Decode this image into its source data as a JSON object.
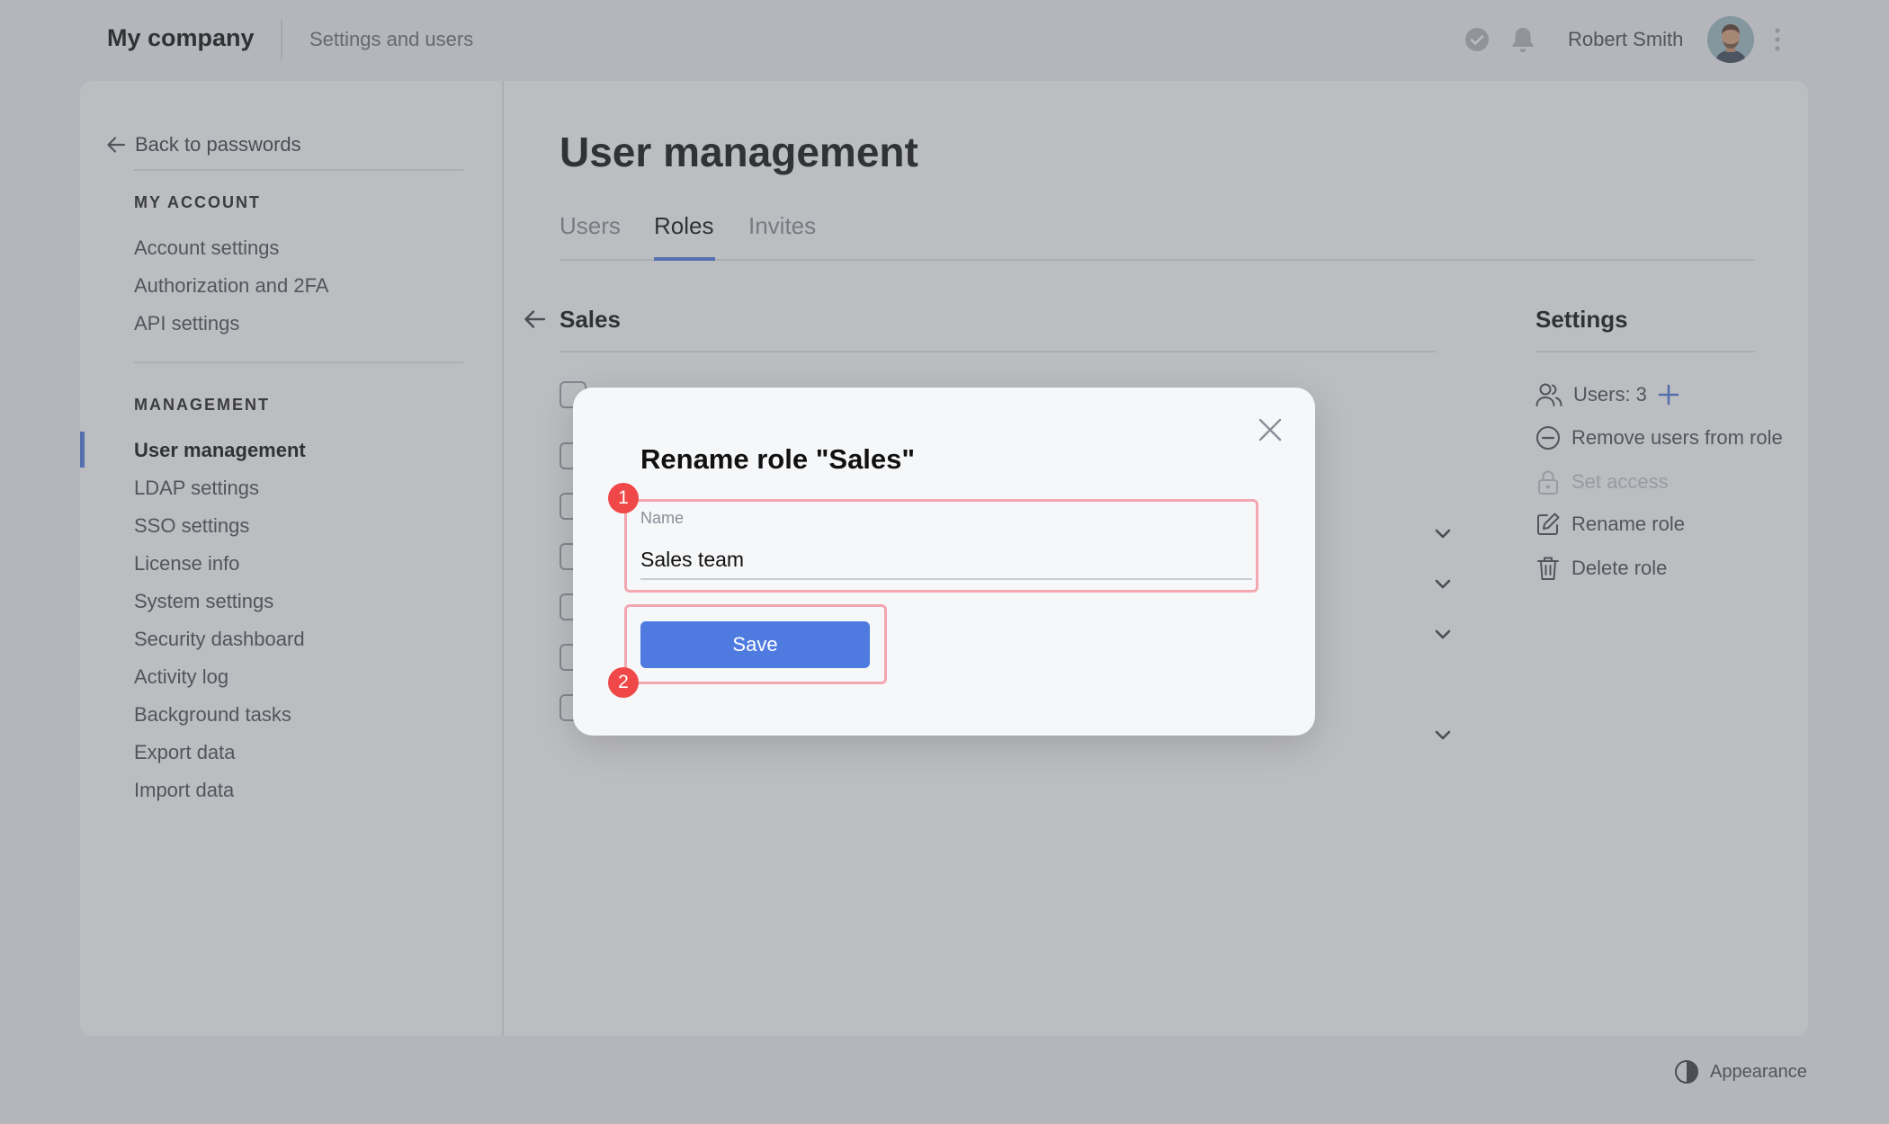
{
  "header": {
    "brand": "My company",
    "section": "Settings and users",
    "user_name": "Robert Smith"
  },
  "sidebar": {
    "back_label": "Back to passwords",
    "my_account_heading": "MY ACCOUNT",
    "account_items": [
      "Account settings",
      "Authorization and 2FA",
      "API settings"
    ],
    "management_heading": "MANAGEMENT",
    "management_items": [
      "User management",
      "LDAP settings",
      "SSO settings",
      "License info",
      "System settings",
      "Security dashboard",
      "Activity log",
      "Background tasks",
      "Export data",
      "Import data"
    ],
    "active_item": "User management"
  },
  "main": {
    "page_title": "User management",
    "tabs": [
      {
        "label": "Users"
      },
      {
        "label": "Roles"
      },
      {
        "label": "Invites"
      }
    ],
    "active_tab": "Roles",
    "role_name": "Sales"
  },
  "settings_panel": {
    "title": "Settings",
    "users_label": "Users: 3",
    "remove_users_label": "Remove users from role",
    "set_access_label": "Set access",
    "rename_role_label": "Rename role",
    "delete_role_label": "Delete role"
  },
  "footer": {
    "appearance_label": "Appearance"
  },
  "modal": {
    "title": "Rename role \"Sales\"",
    "name_label": "Name",
    "name_value": "Sales team",
    "save_label": "Save",
    "badge_1": "1",
    "badge_2": "2"
  },
  "colors": {
    "accent": "#4f7be0",
    "badge": "#f04848",
    "highlight": "#f3a7b0"
  }
}
